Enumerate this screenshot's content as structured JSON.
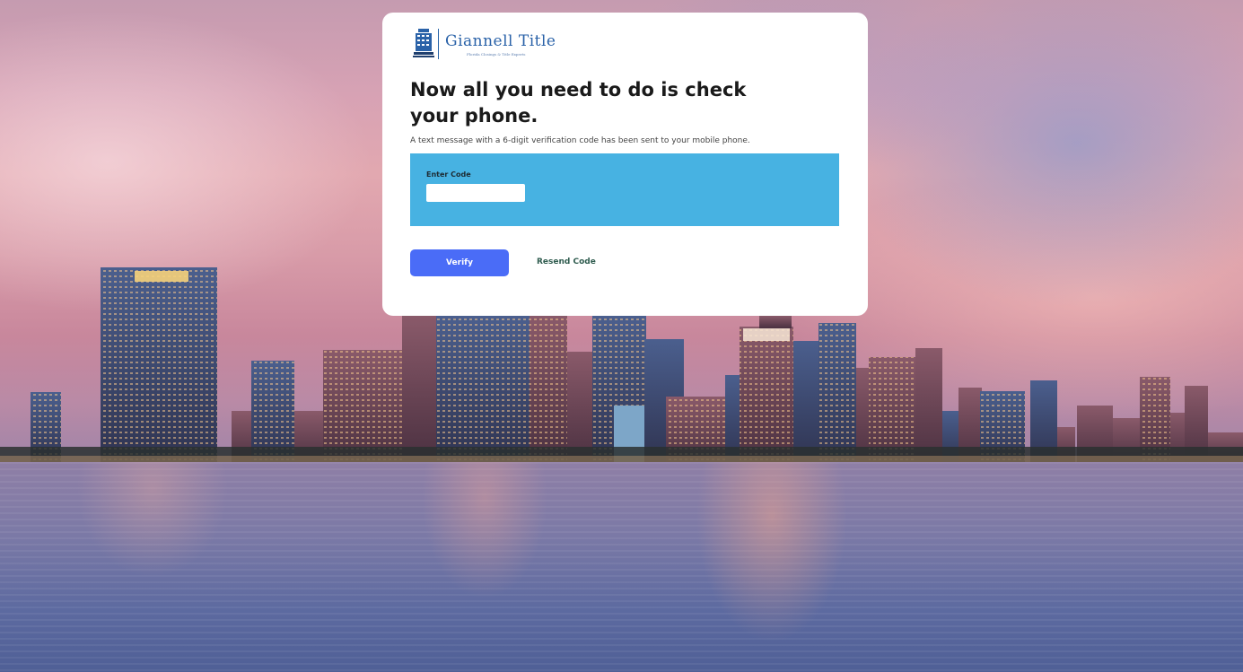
{
  "brand": {
    "name": "Giannell Title",
    "tagline": "Florida Closings & Title Experts",
    "icon": "building-icon",
    "color": "#2a62a8"
  },
  "page": {
    "heading": "Now all you need to do is check your phone.",
    "subtext": "A text message with a 6-digit verification code has been sent to your mobile phone."
  },
  "form": {
    "code_label": "Enter Code",
    "code_value": "",
    "code_placeholder": "",
    "panel_color": "#47b2e2"
  },
  "actions": {
    "verify_label": "Verify",
    "verify_color": "#4a6cf7",
    "resend_label": "Resend Code"
  }
}
